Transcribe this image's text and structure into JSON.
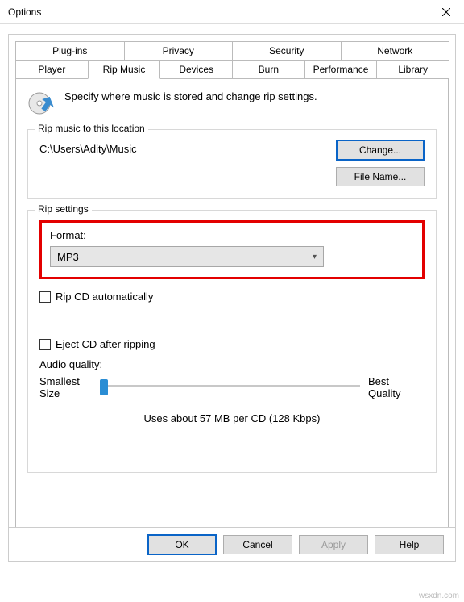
{
  "window": {
    "title": "Options"
  },
  "tabs_row1": [
    {
      "label": "Plug-ins"
    },
    {
      "label": "Privacy"
    },
    {
      "label": "Security"
    },
    {
      "label": "Network"
    }
  ],
  "tabs_row2": [
    {
      "label": "Player"
    },
    {
      "label": "Rip Music",
      "active": true
    },
    {
      "label": "Devices"
    },
    {
      "label": "Burn"
    },
    {
      "label": "Performance"
    },
    {
      "label": "Library"
    }
  ],
  "header_text": "Specify where music is stored and change rip settings.",
  "group_location": {
    "title": "Rip music to this location",
    "path": "C:\\Users\\Adity\\Music",
    "change_btn": "Change...",
    "filename_btn": "File Name..."
  },
  "group_settings": {
    "title": "Rip settings",
    "format_label": "Format:",
    "format_value": "MP3",
    "rip_auto": "Rip CD automatically",
    "eject": "Eject CD after ripping",
    "aq_label": "Audio quality:",
    "aq_left1": "Smallest",
    "aq_left2": "Size",
    "aq_right1": "Best",
    "aq_right2": "Quality",
    "aq_info": "Uses about 57 MB per CD (128 Kbps)"
  },
  "footer": {
    "ok": "OK",
    "cancel": "Cancel",
    "apply": "Apply",
    "help": "Help"
  },
  "watermark": "wsxdn.com"
}
